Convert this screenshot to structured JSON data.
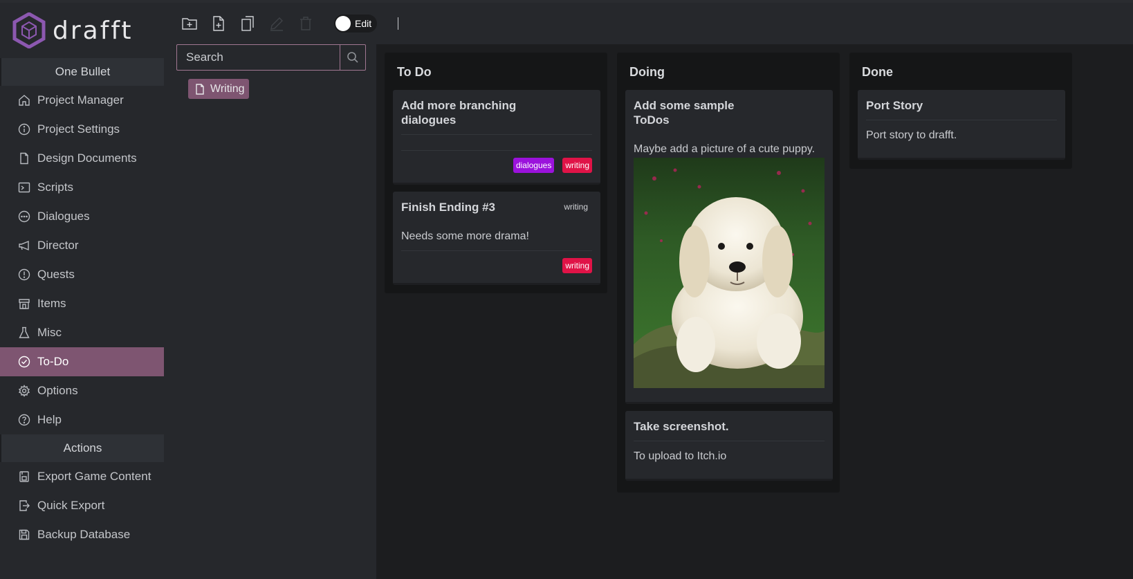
{
  "app": {
    "name": "drafft"
  },
  "sidebar": {
    "section1": "One Bullet",
    "items": [
      {
        "label": "Project Manager",
        "icon": "home-icon"
      },
      {
        "label": "Project Settings",
        "icon": "info-icon"
      },
      {
        "label": "Design Documents",
        "icon": "document-icon"
      },
      {
        "label": "Scripts",
        "icon": "terminal-icon"
      },
      {
        "label": "Dialogues",
        "icon": "chat-icon"
      },
      {
        "label": "Director",
        "icon": "megaphone-icon"
      },
      {
        "label": "Quests",
        "icon": "alert-icon"
      },
      {
        "label": "Items",
        "icon": "store-icon"
      },
      {
        "label": "Misc",
        "icon": "flask-icon"
      },
      {
        "label": "To-Do",
        "icon": "check-circle-icon",
        "active": true
      },
      {
        "label": "Options",
        "icon": "gear-icon"
      },
      {
        "label": "Help",
        "icon": "question-icon"
      }
    ],
    "section2": "Actions",
    "actions": [
      {
        "label": "Export Game Content",
        "icon": "export-icon"
      },
      {
        "label": "Quick Export",
        "icon": "quick-export-icon"
      },
      {
        "label": "Backup Database",
        "icon": "save-icon"
      }
    ]
  },
  "toolbar": {
    "edit_label": "Edit"
  },
  "search": {
    "placeholder": "Search"
  },
  "tree": {
    "item": "Writing"
  },
  "board": {
    "columns": [
      {
        "title": "To Do",
        "cards": [
          {
            "title": "Add more branching dialogues",
            "body": "",
            "tags": [
              "dialogues",
              "writing"
            ]
          },
          {
            "title": "Finish Ending #3",
            "corner": "writing",
            "body": "Needs some more drama!",
            "tags": [
              "writing"
            ]
          }
        ]
      },
      {
        "title": "Doing",
        "cards": [
          {
            "title": "Add some sample ToDos",
            "body": "Maybe add a picture of a cute puppy."
          },
          {
            "title": "Take screenshot.",
            "body": "To upload to Itch.io"
          }
        ]
      },
      {
        "title": "Done",
        "cards": [
          {
            "title": "Port Story",
            "body": "Port story to drafft."
          }
        ]
      }
    ]
  },
  "colors": {
    "accent": "#7e5571",
    "tag_dialogues": "#9b12dc",
    "tag_writing": "#e01347"
  }
}
